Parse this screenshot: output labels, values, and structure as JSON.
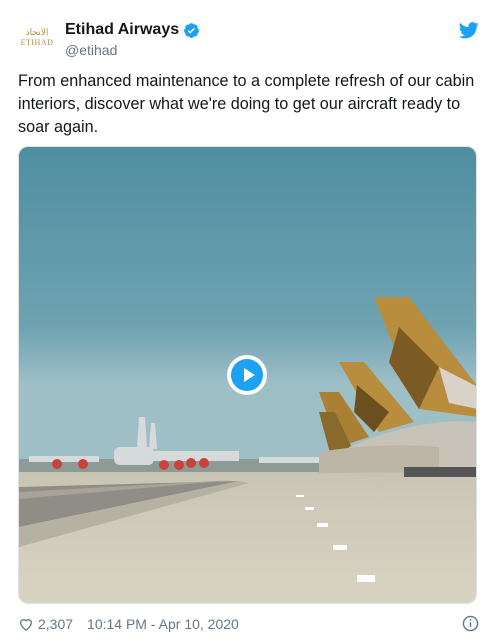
{
  "account": {
    "display_name": "Etihad Airways",
    "handle": "@etihad",
    "logo_arabic": "الاتحاد",
    "logo_english": "ETIHAD",
    "verified_icon": "verified-badge-icon",
    "brand_color": "#b28a3c"
  },
  "tweet": {
    "text": "From enhanced maintenance to a complete refresh of our cabin interiors, discover what we're doing to get our aircraft ready to soar again."
  },
  "media": {
    "type": "video",
    "play_icon": "play-icon",
    "accent": "#1da1f2"
  },
  "footer": {
    "likes": "2,307",
    "timestamp": "10:14 PM - Apr 10, 2020",
    "heart_icon": "heart-icon",
    "info_icon": "info-icon"
  },
  "colors": {
    "twitter_blue": "#1da1f2",
    "secondary_text": "#657786"
  }
}
